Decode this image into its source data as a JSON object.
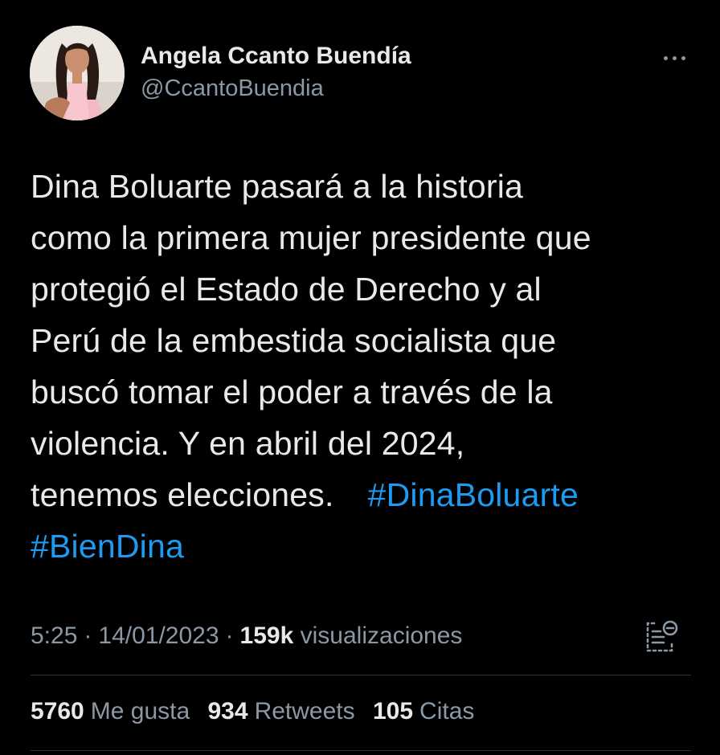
{
  "author": {
    "display_name": "Angela Ccanto Buendía",
    "handle": "@CcantoBuendia",
    "avatar_icon": "profile-photo"
  },
  "menu": {
    "more_icon": "more-horizontal-icon"
  },
  "tweet": {
    "lines": [
      "Dina Boluarte pasará a la historia",
      "como la primera mujer presidente que",
      "protegió el Estado de Derecho y al",
      "Perú de la embestida socialista que",
      "buscó tomar el poder a través de la",
      "violencia. Y en abril del 2024,",
      "tenemos elecciones."
    ],
    "hashtags": [
      "#DinaBoluarte",
      "#BienDina"
    ]
  },
  "meta": {
    "time": "5:25",
    "separator": "·",
    "date": "14/01/2023",
    "views_count": "159k",
    "views_label": "visualizaciones",
    "analytics_icon": "analytics-icon"
  },
  "stats": [
    {
      "count": "5760",
      "label": "Me gusta"
    },
    {
      "count": "934",
      "label": "Retweets"
    },
    {
      "count": "105",
      "label": "Citas"
    }
  ],
  "colors": {
    "background": "#000000",
    "text_primary": "#e7e9ea",
    "text_secondary": "#8b98a5",
    "link": "#1d9bf0",
    "divider": "#2f3336"
  }
}
